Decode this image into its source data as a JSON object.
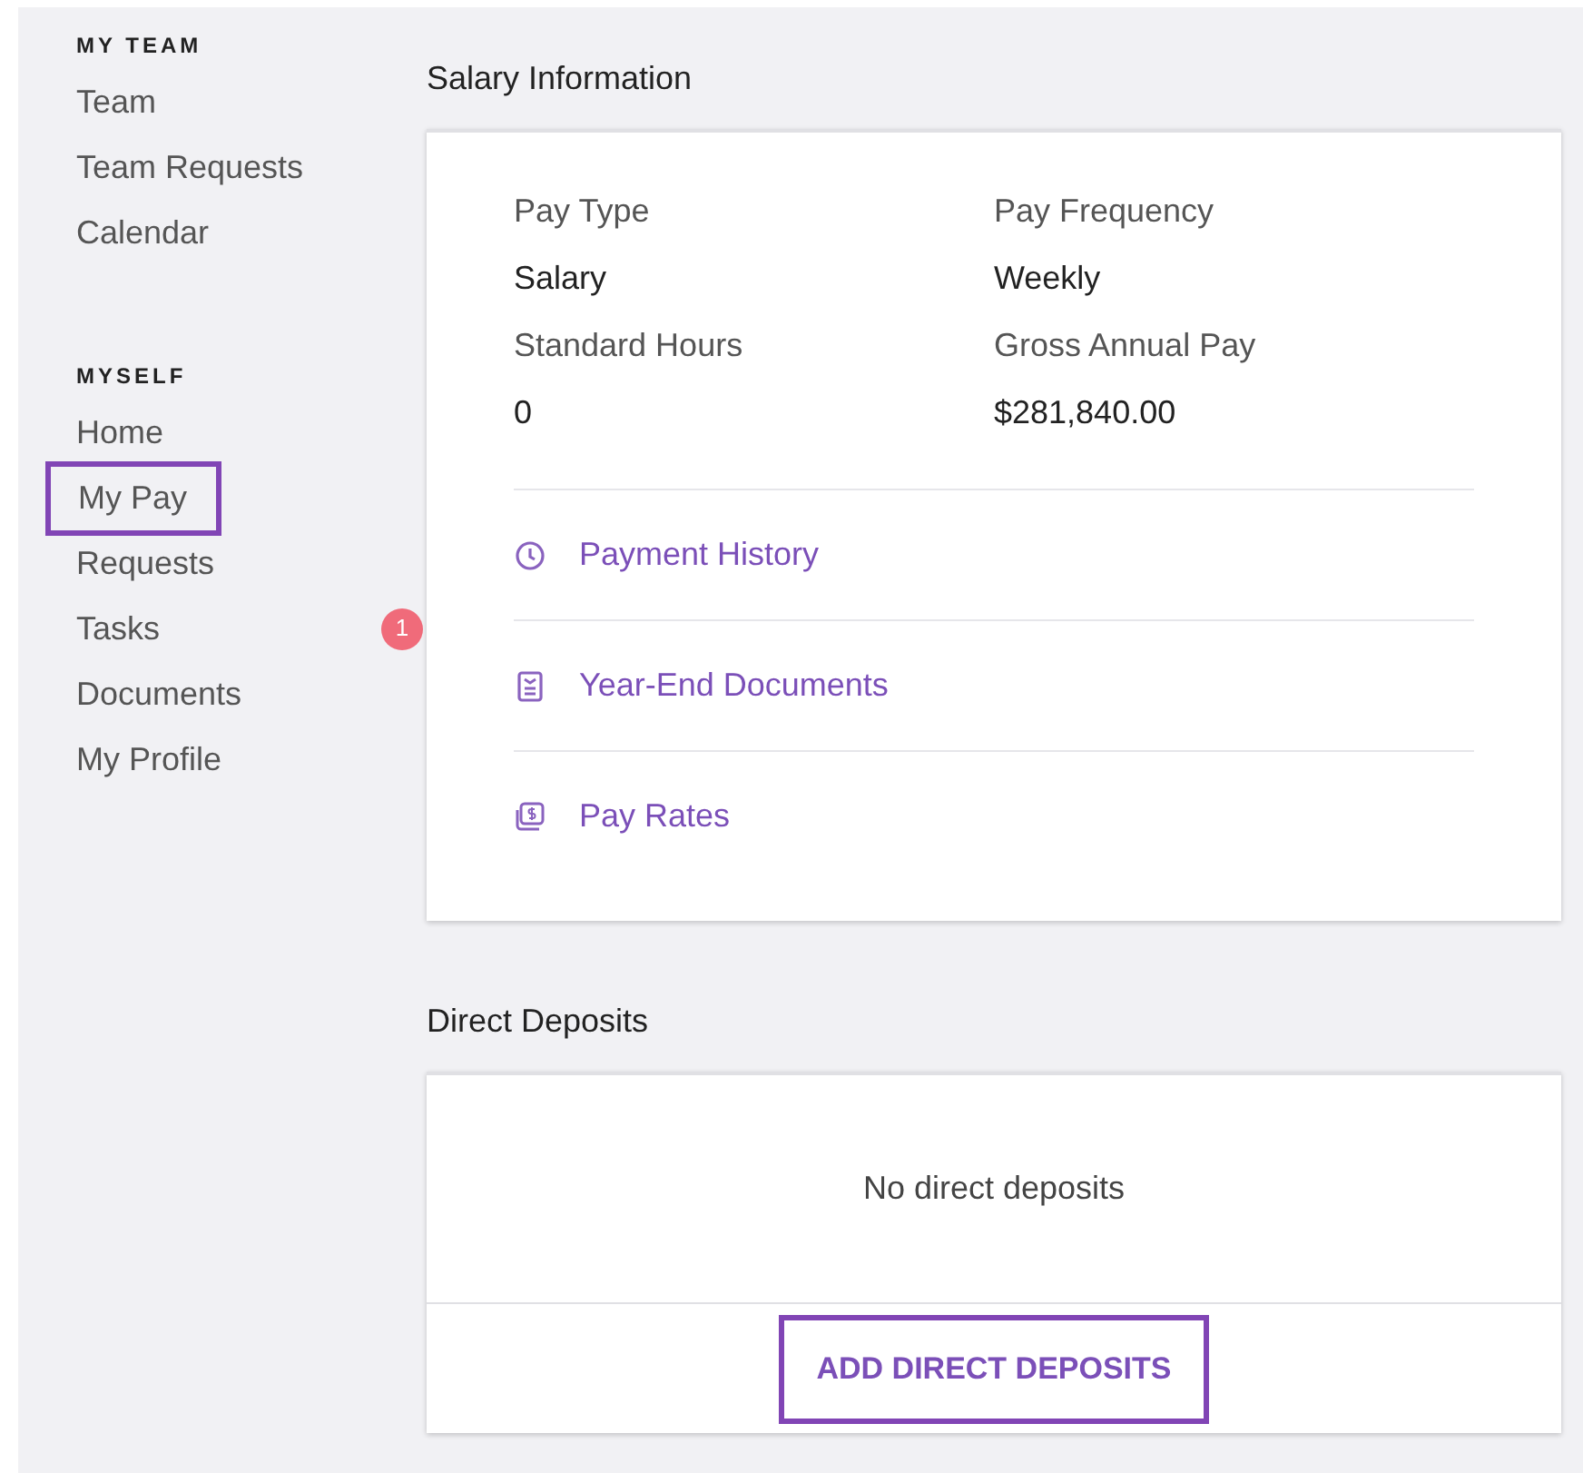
{
  "sidebar": {
    "sections": [
      {
        "heading": "MY TEAM",
        "items": [
          {
            "label": "Team",
            "highlighted": false
          },
          {
            "label": "Team Requests",
            "highlighted": false
          },
          {
            "label": "Calendar",
            "highlighted": false
          }
        ]
      },
      {
        "heading": "MYSELF",
        "items": [
          {
            "label": "Home",
            "highlighted": false
          },
          {
            "label": "My Pay",
            "highlighted": true
          },
          {
            "label": "Requests",
            "highlighted": false
          },
          {
            "label": "Tasks",
            "highlighted": false,
            "badge": "1"
          },
          {
            "label": "Documents",
            "highlighted": false
          },
          {
            "label": "My Profile",
            "highlighted": false
          }
        ]
      }
    ]
  },
  "salary_information": {
    "title": "Salary Information",
    "fields": [
      {
        "label": "Pay Type",
        "value": "Salary"
      },
      {
        "label": "Pay Frequency",
        "value": "Weekly"
      },
      {
        "label": "Standard Hours",
        "value": "0"
      },
      {
        "label": "Gross Annual Pay",
        "value": "$281,840.00"
      }
    ],
    "links": [
      {
        "kind": "clock",
        "label": "Payment History"
      },
      {
        "kind": "document",
        "label": "Year-End Documents"
      },
      {
        "kind": "money",
        "label": "Pay Rates"
      }
    ]
  },
  "direct_deposits": {
    "title": "Direct Deposits",
    "empty_message": "No direct deposits",
    "button": {
      "label": "ADD DIRECT DEPOSITS",
      "highlighted": true
    }
  }
}
